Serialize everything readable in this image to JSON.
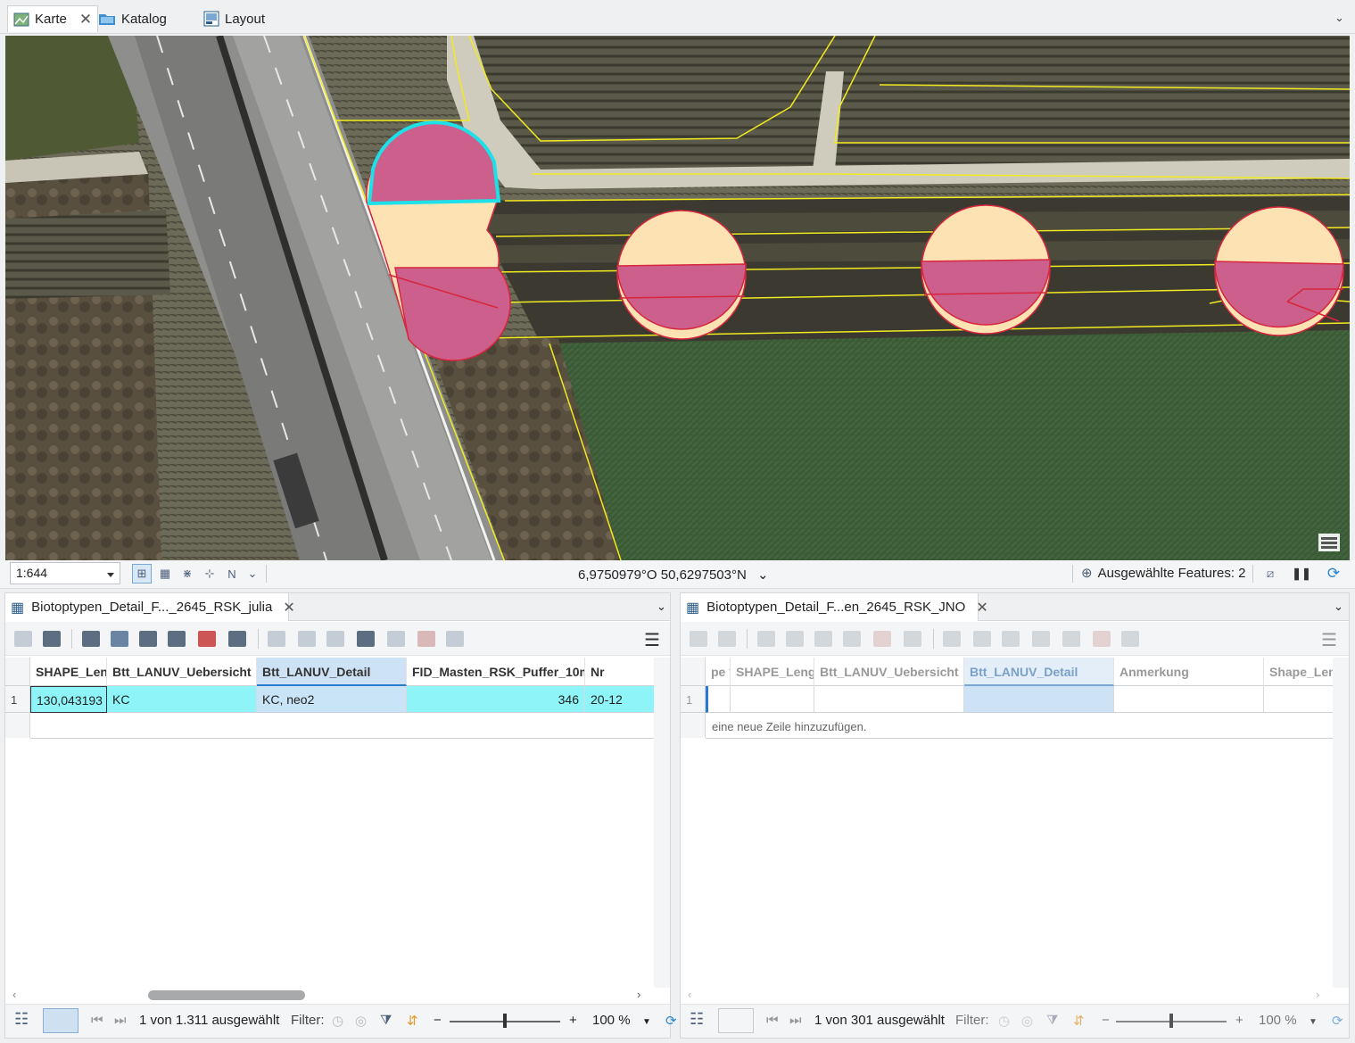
{
  "top_tabs": [
    {
      "label": "Karte",
      "icon": "map-icon",
      "active": true
    },
    {
      "label": "Katalog",
      "icon": "catalog-folder-icon",
      "active": false
    },
    {
      "label": "Layout",
      "icon": "layout-icon",
      "active": false
    }
  ],
  "map": {
    "description_icons": [
      "overview-icon"
    ]
  },
  "status": {
    "scale": "1:644",
    "coordinates": "6,9750979°O 50,6297503°N",
    "selected_features": "Ausgewählte Features: 2"
  },
  "left_table": {
    "tab_title": "Biotoptypen_Detail_F..._2645_RSK_julia",
    "columns": [
      "SHAPE_Leng",
      "Btt_LANUV_Uebersicht",
      "Btt_LANUV_Detail",
      "FID_Masten_RSK_Puffer_10m",
      "Nr"
    ],
    "rows": [
      {
        "num": "1",
        "cells": [
          "130,043193",
          "KC",
          "KC, neo2",
          "346",
          "20-12"
        ]
      }
    ],
    "footer": {
      "selection": "1 von 1.311 ausgewählt",
      "filter_label": "Filter:",
      "zoom": "100 %"
    }
  },
  "right_table": {
    "tab_title": "Biotoptypen_Detail_F...en_2645_RSK_JNO",
    "columns": [
      "pe *",
      "SHAPE_Leng",
      "Btt_LANUV_Uebersicht",
      "Btt_LANUV_Detail",
      "Anmerkung",
      "Shape_Len"
    ],
    "rows": [
      {
        "num": "1",
        "cells": [
          "",
          "",
          "",
          "",
          "",
          ""
        ]
      }
    ],
    "new_row_hint": "eine neue Zeile hinzuzufügen.",
    "footer": {
      "selection": "1 von 301 ausgewählt",
      "filter_label": "Filter:",
      "zoom": "100 %"
    }
  },
  "colors": {
    "selection_cyan": "#8ef4f8",
    "active_header": "#cde2f5",
    "buffer_fill": "#cc5f8c",
    "buffer_light": "#fde3b4",
    "selection_outline": "#1ee0e8",
    "parcel_line": "#f2ea20"
  }
}
